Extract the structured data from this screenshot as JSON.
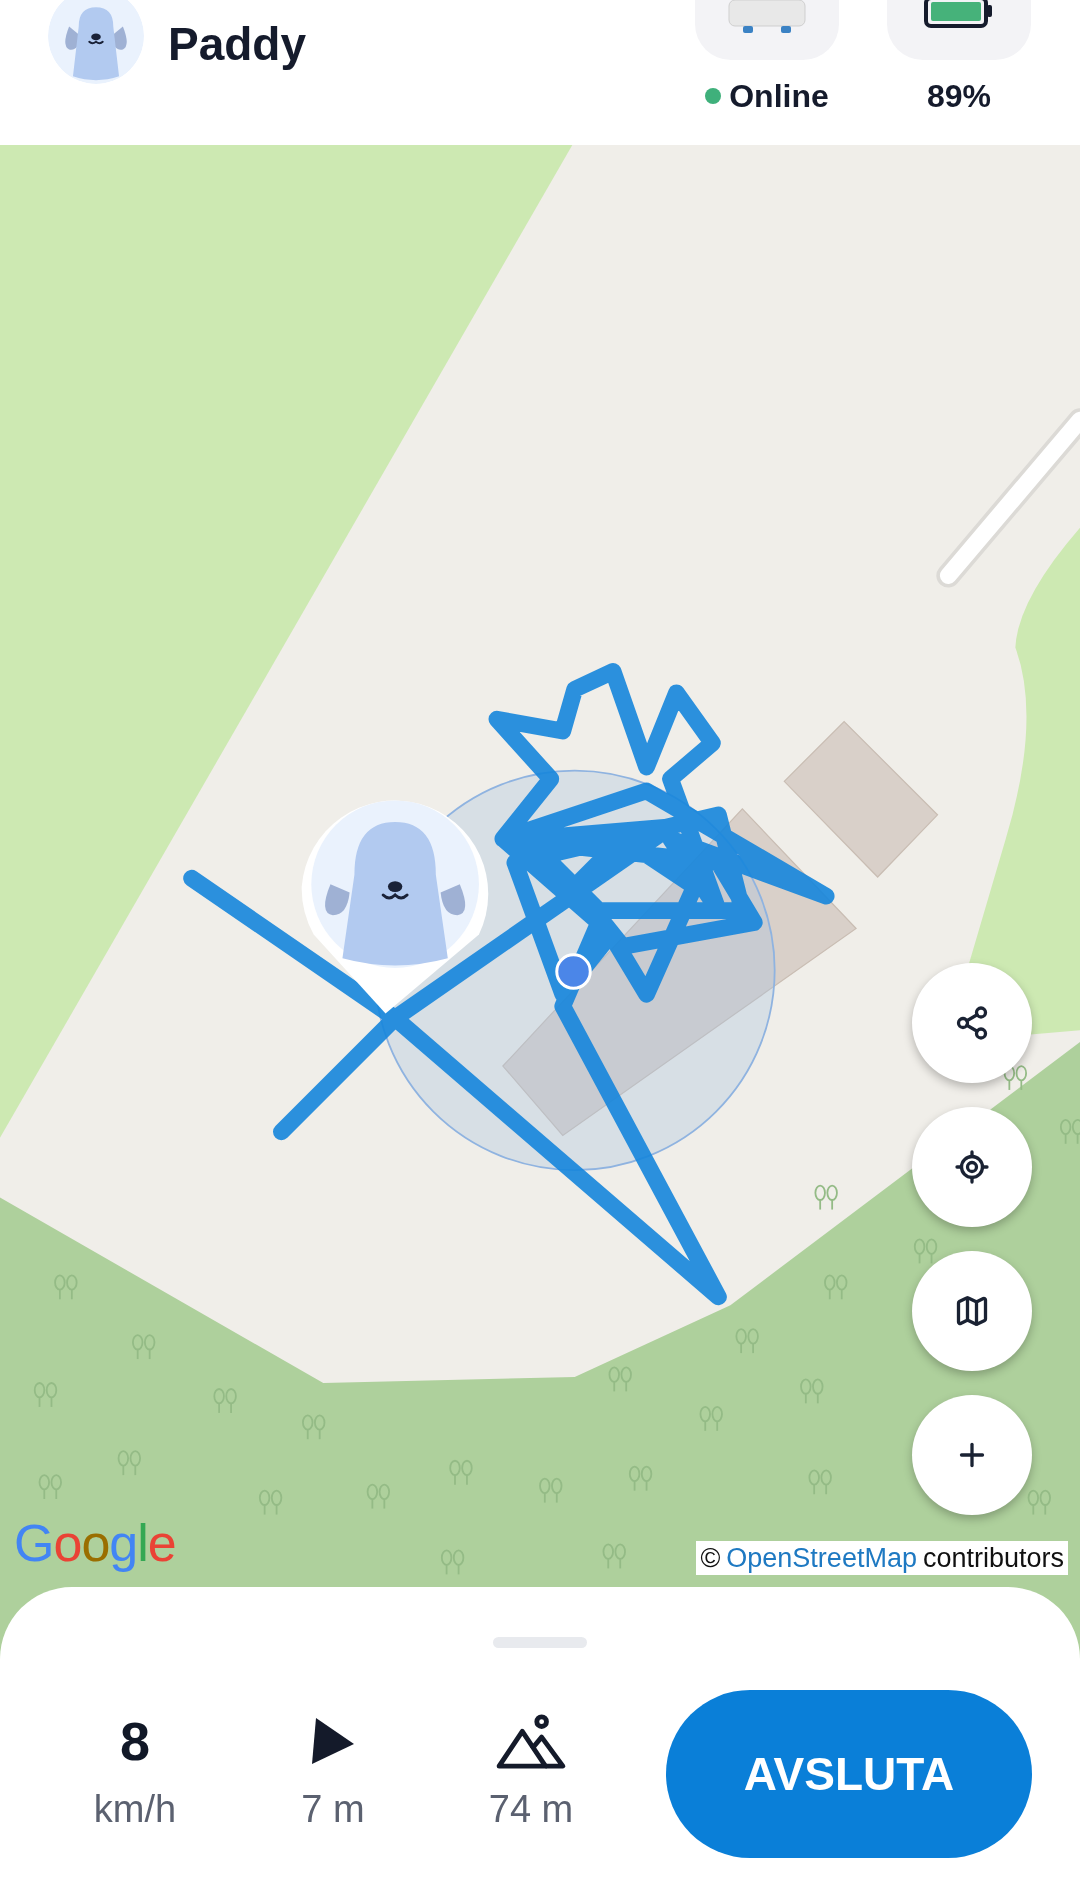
{
  "header": {
    "pet_name": "Paddy",
    "status": {
      "label": "Online",
      "online": true
    },
    "battery": {
      "label": "89%"
    }
  },
  "map": {
    "logo": "Google",
    "attribution": {
      "prefix": "©",
      "link": "OpenStreetMap",
      "suffix": "contributors"
    },
    "controls": [
      {
        "kind": "share"
      },
      {
        "kind": "locate"
      },
      {
        "kind": "map"
      },
      {
        "kind": "zoom-in"
      }
    ]
  },
  "stats": [
    {
      "kind": "speed",
      "value": "8",
      "label": "km/h"
    },
    {
      "kind": "direction",
      "label": "7 m"
    },
    {
      "kind": "altitude",
      "label": "74 m"
    }
  ],
  "end_button": "AVSLUTA"
}
